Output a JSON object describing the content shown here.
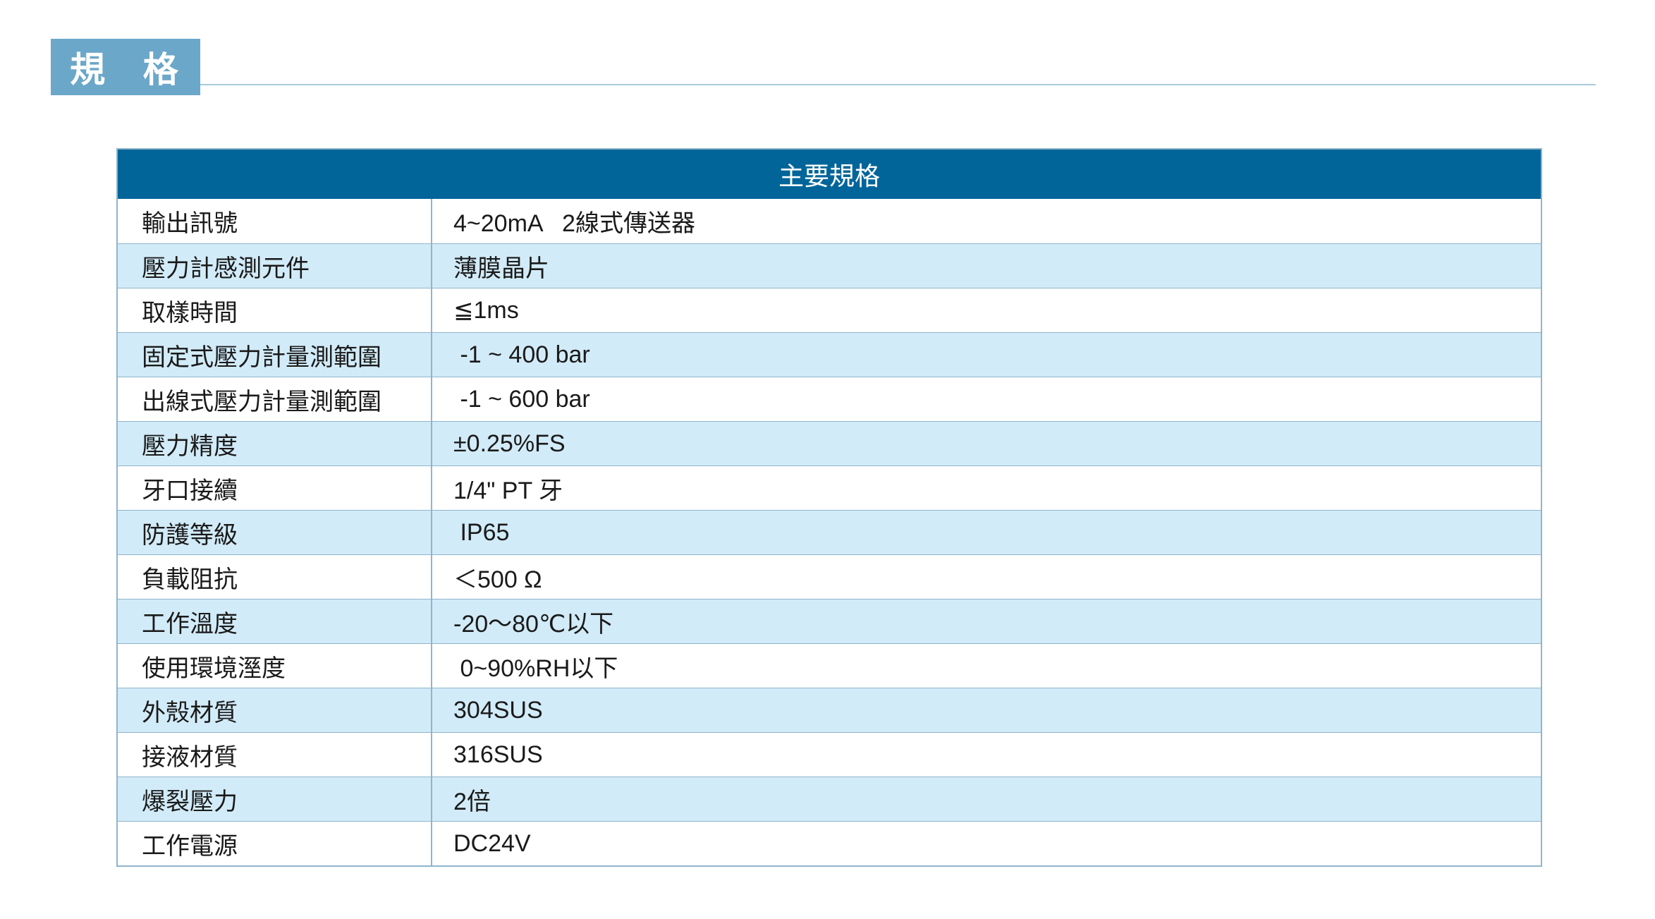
{
  "section": {
    "title": "規 格"
  },
  "table": {
    "header": "主要規格",
    "rows": [
      {
        "label": "輸出訊號",
        "value": "4~20mA   2線式傳送器"
      },
      {
        "label": "壓力計感測元件",
        "value": "薄膜晶片"
      },
      {
        "label": "取樣時間",
        "value": "≦1ms"
      },
      {
        "label": "固定式壓力計量測範圍",
        "value": " -1 ~ 400 bar"
      },
      {
        "label": "出線式壓力計量測範圍",
        "value": " -1 ~ 600 bar"
      },
      {
        "label": "壓力精度",
        "value": "±0.25%FS"
      },
      {
        "label": "牙口接續",
        "value": "1/4\" PT 牙"
      },
      {
        "label": "防護等級",
        "value": " IP65"
      },
      {
        "label": "負載阻抗",
        "value": "＜500 Ω"
      },
      {
        "label": "工作溫度",
        "value": "-20～80℃以下"
      },
      {
        "label": "使用環境溼度",
        "value": " 0~90%RH以下"
      },
      {
        "label": "外殼材質",
        "value": "304SUS"
      },
      {
        "label": "接液材質",
        "value": "316SUS"
      },
      {
        "label": "爆裂壓力",
        "value": "2倍"
      },
      {
        "label": "工作電源",
        "value": "DC24V"
      }
    ]
  },
  "colors": {
    "tab": "#6ba7c9",
    "header": "#02659a",
    "alt_row": "#d2ebf8",
    "border": "#8fb5cb"
  }
}
